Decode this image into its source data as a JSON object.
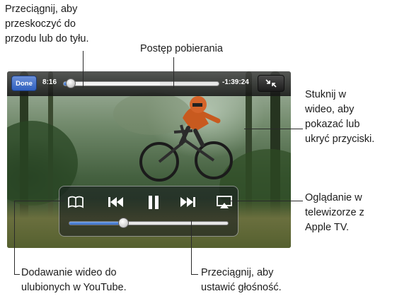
{
  "callouts": {
    "scrub": [
      "Przeciągnij, aby",
      "przeskoczyć do",
      "przodu lub do tyłu."
    ],
    "download": "Postęp pobierania",
    "tap": [
      "Stuknij w",
      "wideo, aby",
      "pokazać lub",
      "ukryć przyciski."
    ],
    "appletv": [
      "Oglądanie w",
      "telewizorze z",
      "Apple TV."
    ],
    "bookmark": [
      "Dodawanie wideo do",
      "ulubionych w YouTube."
    ],
    "volume": [
      "Przeciągnij, aby",
      "ustawić głośność."
    ]
  },
  "player": {
    "done_label": "Done",
    "elapsed": "8:16",
    "remaining": "-1:39:24",
    "playback_progress": 0.05,
    "download_progress": 0.62,
    "volume_level": 0.34
  },
  "icons": {
    "bookmark": "bookmark-icon",
    "previous": "previous-icon",
    "pause": "pause-icon",
    "next": "next-icon",
    "airplay": "airplay-icon",
    "fullscreen": "exit-fullscreen-icon"
  },
  "colors": {
    "accent_blue": "#2f67c6",
    "done_blue": "#2f5fbe"
  }
}
